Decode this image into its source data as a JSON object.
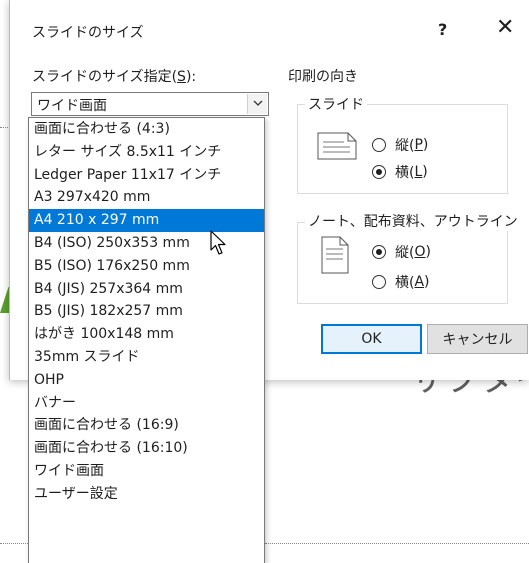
{
  "dialog": {
    "title": "スライドのサイズ",
    "help_label": "?",
    "close_label": "✕"
  },
  "size_section": {
    "label_prefix": "スライドのサイズ指定(",
    "label_key": "S",
    "label_suffix": "):",
    "current_value": "ワイド画面"
  },
  "dropdown": {
    "items": [
      "画面に合わせる (4:3)",
      "レター サイズ 8.5x11 インチ",
      "Ledger Paper 11x17 インチ",
      "A3 297x420 mm",
      "A4 210 x 297 mm",
      "B4 (ISO) 250x353 mm",
      "B5 (ISO) 176x250 mm",
      "B4 (JIS) 257x364 mm",
      "B5 (JIS) 182x257 mm",
      "はがき 100x148 mm",
      "35mm スライド",
      "OHP",
      "バナー",
      "画面に合わせる (16:9)",
      "画面に合わせる (16:10)",
      "ワイド画面",
      "ユーザー設定"
    ],
    "highlighted": "A4 210 x 297 mm"
  },
  "orientation": {
    "group_label": "印刷の向き",
    "slide": {
      "label": "スライド",
      "portrait_prefix": "縦(",
      "portrait_key": "P",
      "portrait_suffix": ")",
      "landscape_prefix": "横(",
      "landscape_key": "L",
      "landscape_suffix": ")",
      "selected": "landscape"
    },
    "notes": {
      "label": "ノート、配布資料、アウトライン",
      "portrait_prefix": "縦(",
      "portrait_key": "O",
      "portrait_suffix": ")",
      "landscape_prefix": "横(",
      "landscape_key": "A",
      "landscape_suffix": ")",
      "selected": "portrait"
    }
  },
  "buttons": {
    "ok": "OK",
    "cancel": "キャンセル"
  },
  "background": {
    "subtitle_text": "サブタイ"
  },
  "colors": {
    "accent": "#0078d7",
    "slide_green": "#5aa02c"
  }
}
